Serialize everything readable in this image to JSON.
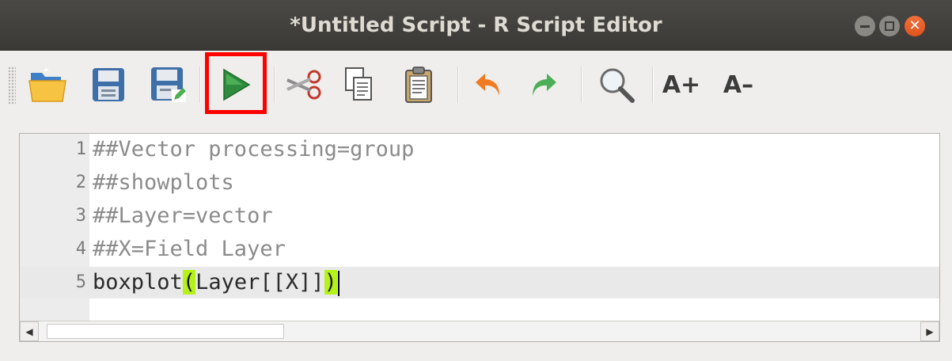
{
  "window": {
    "title": "*Untitled Script - R Script Editor",
    "controls": {
      "minimize": "minimize-icon",
      "maximize": "maximize-icon",
      "close": "close-icon",
      "close_glyph": "✕"
    }
  },
  "toolbar": {
    "buttons": [
      {
        "name": "open-script",
        "icon": "folder-open-icon"
      },
      {
        "name": "save-script",
        "icon": "save-icon"
      },
      {
        "name": "save-as",
        "icon": "save-as-icon"
      },
      {
        "name": "run-script",
        "icon": "run-icon",
        "highlighted": true
      },
      {
        "name": "cut",
        "icon": "scissors-icon"
      },
      {
        "name": "copy",
        "icon": "copy-icon"
      },
      {
        "name": "paste",
        "icon": "paste-icon"
      },
      {
        "name": "undo",
        "icon": "undo-icon"
      },
      {
        "name": "redo",
        "icon": "redo-icon"
      },
      {
        "name": "find-replace",
        "icon": "magnifier-icon"
      }
    ],
    "increase_font_label": "A+",
    "decrease_font_label": "A–",
    "highlight_color": "#ff0000"
  },
  "editor": {
    "lines": [
      {
        "number": "1",
        "text": "##Vector processing=group"
      },
      {
        "number": "2",
        "text": "##showplots"
      },
      {
        "number": "3",
        "text": "##Layer=vector"
      },
      {
        "number": "4",
        "text": "##X=Field Layer"
      }
    ],
    "current_line": {
      "number": "5",
      "prefix": "boxplot",
      "open_brace": "(",
      "middle": "Layer[[X]]",
      "close_brace": ")"
    },
    "brace_match_color": "#b4f21a"
  },
  "scrollbar": {
    "left_arrow": "◀",
    "right_arrow": "▶"
  }
}
